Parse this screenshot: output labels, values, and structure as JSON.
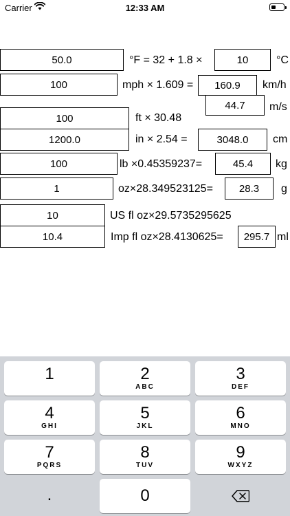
{
  "status_bar": {
    "carrier": "Carrier",
    "time": "12:33 AM",
    "battery_level": 0.4
  },
  "converters": {
    "temperature": {
      "input": "50.0",
      "formula": "°F = 32 + 1.8 ×",
      "output": "10",
      "unit": "°C"
    },
    "speed": {
      "input": "100",
      "formula": "mph × 1.609 =",
      "output_kmh": "160.9",
      "unit_kmh": "km/h",
      "output_ms": "44.7",
      "unit_ms": "m/s"
    },
    "feet": {
      "input": "100",
      "formula": "ft × 30.48"
    },
    "inches": {
      "input": "1200.0",
      "formula": "in × 2.54 =",
      "output": "3048.0",
      "unit": "cm"
    },
    "pounds": {
      "input": "100",
      "formula": "lb ×0.45359237=",
      "output": "45.4",
      "unit": "kg"
    },
    "ounces": {
      "input": "1",
      "formula": "oz×28.349523125=",
      "output": "28.3",
      "unit": "g"
    },
    "us_fl_oz": {
      "input": "10",
      "formula": "US fl oz×29.5735295625"
    },
    "imp_fl_oz": {
      "input": "10.4",
      "formula": "Imp fl oz×28.4130625=",
      "output": "295.7",
      "unit": "ml"
    }
  },
  "keypad": {
    "keys": [
      {
        "num": "1",
        "letters": ""
      },
      {
        "num": "2",
        "letters": "ABC"
      },
      {
        "num": "3",
        "letters": "DEF"
      },
      {
        "num": "4",
        "letters": "GHI"
      },
      {
        "num": "5",
        "letters": "JKL"
      },
      {
        "num": "6",
        "letters": "MNO"
      },
      {
        "num": "7",
        "letters": "PQRS"
      },
      {
        "num": "8",
        "letters": "TUV"
      },
      {
        "num": "9",
        "letters": "WXYZ"
      },
      {
        "num": "0",
        "letters": ""
      }
    ],
    "decimal": ".",
    "delete_icon": "backspace-icon"
  }
}
